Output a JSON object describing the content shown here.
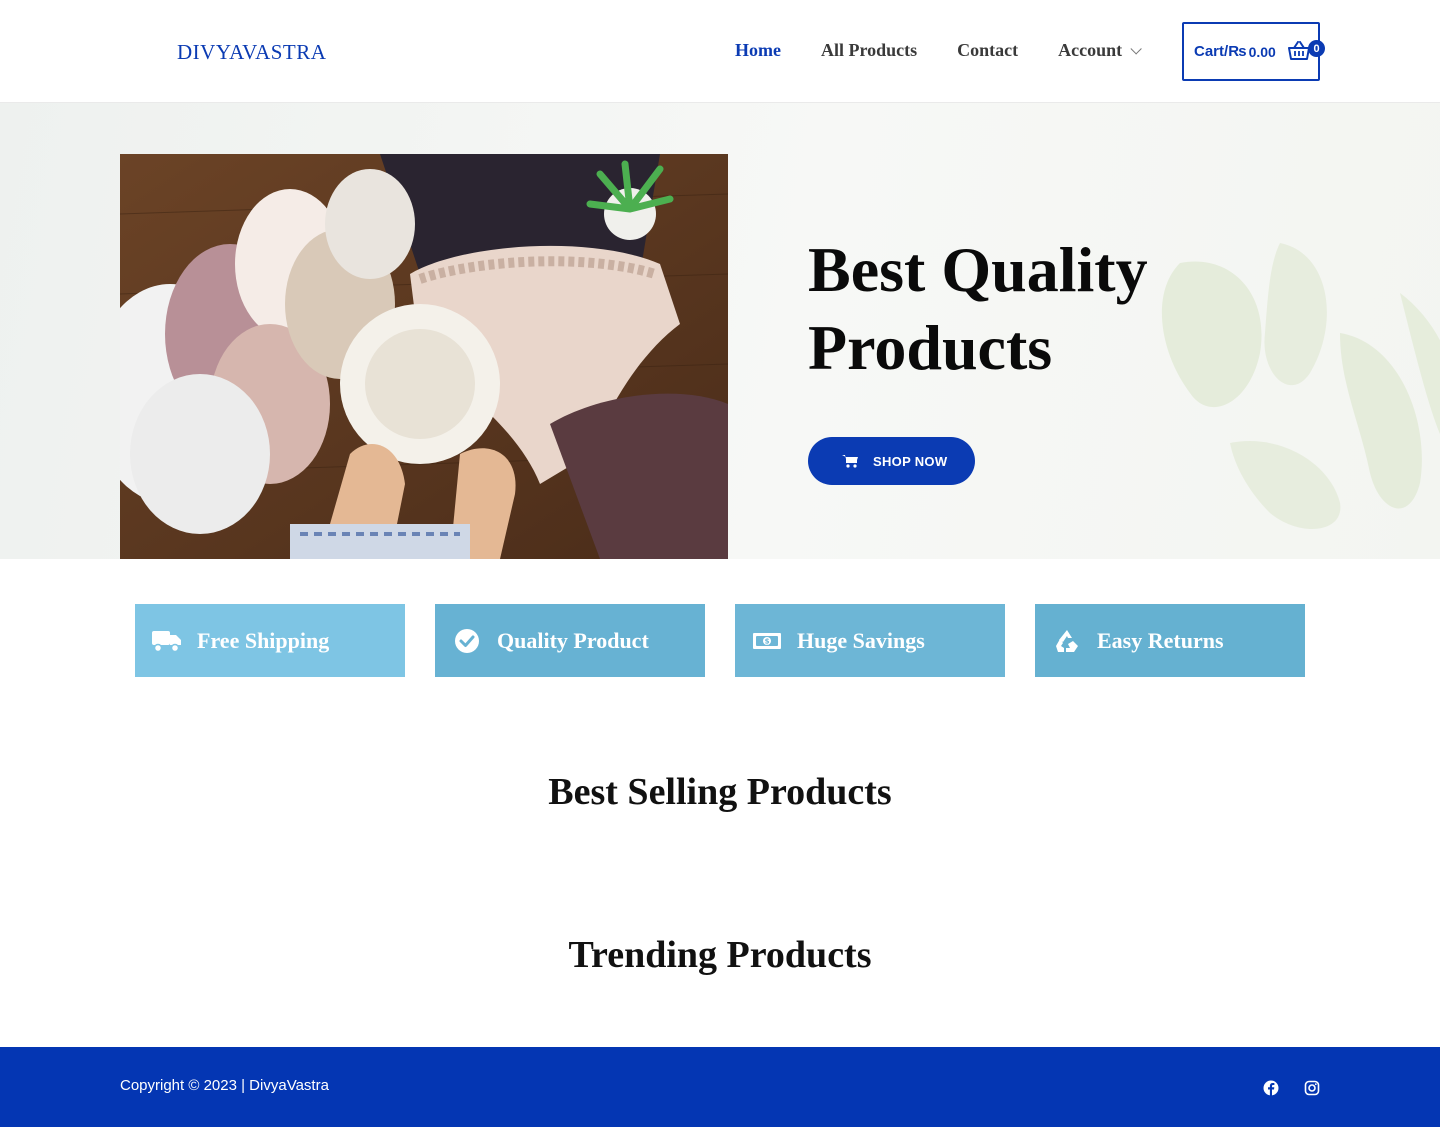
{
  "header": {
    "logo": "DIVYAVASTRA",
    "nav": [
      {
        "label": "Home",
        "active": true
      },
      {
        "label": "All Products",
        "active": false
      },
      {
        "label": "Contact",
        "active": false
      },
      {
        "label": "Account",
        "active": false
      }
    ],
    "cart": {
      "label": "Cart/",
      "currency": "₨",
      "amount": "0.00",
      "count": "0"
    }
  },
  "hero": {
    "title_line1": "Best Quality",
    "title_line2": "Products",
    "button": "SHOP NOW"
  },
  "features": [
    {
      "label": "Free Shipping",
      "icon": "truck-icon",
      "color": "#7ec5e4"
    },
    {
      "label": "Quality Product",
      "icon": "check-circle-icon",
      "color": "#67b2d3"
    },
    {
      "label": "Huge Savings",
      "icon": "money-icon",
      "color": "#6db6d6"
    },
    {
      "label": "Easy Returns",
      "icon": "recycle-icon",
      "color": "#65b1d1"
    }
  ],
  "sections": {
    "best_selling": "Best Selling Products",
    "trending": "Trending Products"
  },
  "footer": {
    "copyright": "Copyright © 2023 | DivyaVastra",
    "social": [
      "facebook-icon",
      "instagram-icon"
    ]
  },
  "colors": {
    "brand": "#0b3bb3",
    "footer": "#0436b3"
  }
}
